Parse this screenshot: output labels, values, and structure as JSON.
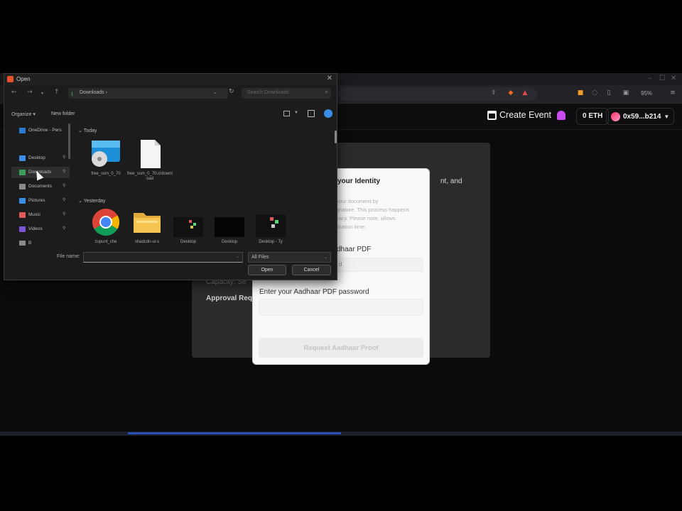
{
  "browser": {
    "zoom": "95%",
    "header": {
      "create_event": "Create Event",
      "eth_balance": "0 ETH",
      "wallet_address": "0x59...b214"
    }
  },
  "event_card": {
    "right_text_fragment": "nt, and",
    "capacity_fragment": "Capacity: Se",
    "approval_fragment": "Approval Req"
  },
  "identity_modal": {
    "title_fragment": "your Identity",
    "desc_lines": [
      "your document by",
      "gnature. This process happens",
      "vacy. Please note, allows",
      "fication time."
    ],
    "pdf_label_fragment": "dhaar PDF",
    "pdf_field_fragment": "d",
    "password_label": "Enter your Aadhaar PDF password",
    "request_button": "Request Aadhaar Proof"
  },
  "open_dialog": {
    "title": "Open",
    "address_path": "Downloads",
    "search_placeholder": "Search Downloads",
    "organize": "Organize ▾",
    "new_folder": "New folder",
    "sidebar": [
      {
        "label": "OneDrive - Pers",
        "color": "#2b7bd6",
        "pinned": false,
        "active": false
      },
      {
        "label": "Desktop",
        "color": "#3a8ee6",
        "pinned": true,
        "active": false
      },
      {
        "label": "Downloads",
        "color": "#3c9e5a",
        "pinned": true,
        "active": true
      },
      {
        "label": "Documents",
        "color": "#8a8a8a",
        "pinned": true,
        "active": false
      },
      {
        "label": "Pictures",
        "color": "#3a8ee6",
        "pinned": true,
        "active": false
      },
      {
        "label": "Music",
        "color": "#e05a5a",
        "pinned": true,
        "active": false
      },
      {
        "label": "Videos",
        "color": "#7b55d6",
        "pinned": true,
        "active": false
      },
      {
        "label": "B",
        "color": "#8a8a8a",
        "pinned": false,
        "active": false
      }
    ],
    "groups": {
      "today": "Today",
      "yesterday": "Yesterday"
    },
    "files_today": [
      {
        "label": "free_ssm_0_70",
        "kind": "disc"
      },
      {
        "label": "free_ssm_0_70.crdownload",
        "kind": "document"
      }
    ],
    "files_yesterday": [
      {
        "label": "zupunt_che",
        "kind": "chrome"
      },
      {
        "label": "shadcdn-ui-s",
        "kind": "folder"
      },
      {
        "label": "Desktop",
        "kind": "screenshot"
      },
      {
        "label": "Desktop",
        "kind": "screenshot-dark"
      },
      {
        "label": "Desktop - Ty",
        "kind": "screenshot"
      }
    ],
    "file_name_label": "File name:",
    "file_name_value": "",
    "file_type": "All Files",
    "open_button": "Open",
    "cancel_button": "Cancel"
  },
  "colors": {
    "accent_purple": "#c94cf0",
    "help_blue": "#3a8ee6",
    "download_green": "#3c9e5a"
  }
}
